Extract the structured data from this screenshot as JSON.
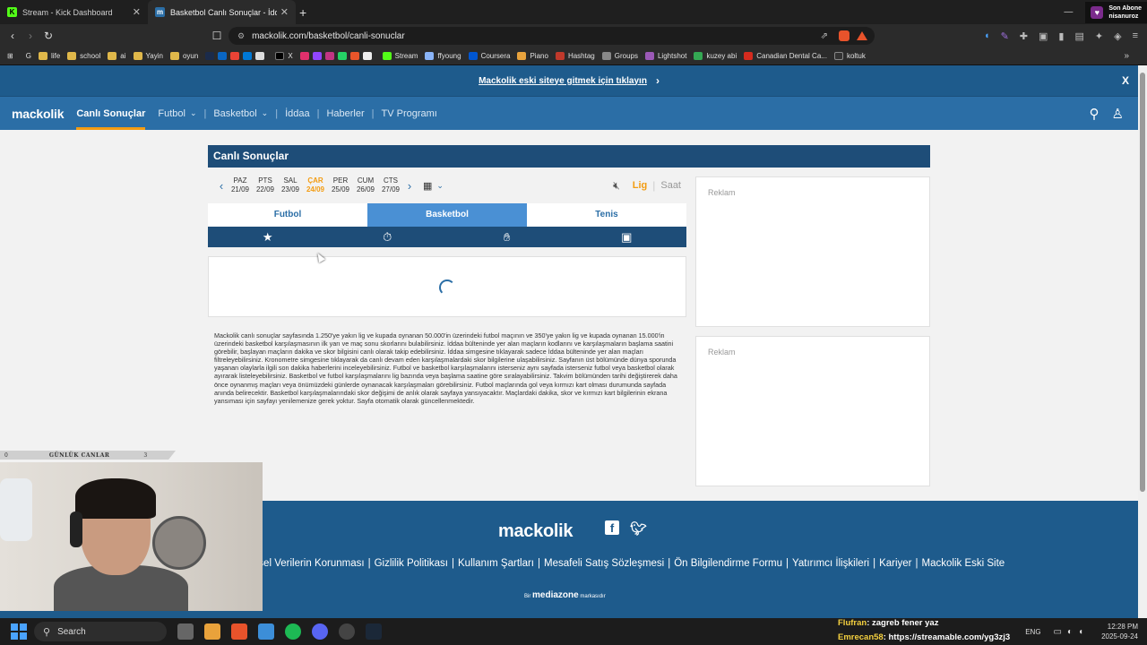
{
  "browser": {
    "tabs": [
      {
        "title": "Stream - Kick Dashboard",
        "favicon": "K",
        "favicon_color": "#53fc18",
        "active": false
      },
      {
        "title": "Basketbol Canlı Sonuçlar - İddaa",
        "favicon": "m",
        "favicon_color": "#2b6ea6",
        "active": true
      }
    ],
    "new_tab": "+",
    "url": "mackolik.com/basketbol/canli-sonuclar",
    "sub_alert": {
      "line1": "Son Abone",
      "line2": "nisanuroz"
    },
    "bookmarks": [
      "life",
      "school",
      "ai",
      "Yayin",
      "oyun",
      "X",
      "Stream",
      "ffyoung",
      "Coursera",
      "Piano",
      "Hashtag",
      "Groups",
      "Lightshot",
      "kuzey abi",
      "Canadian Dental Ca...",
      "koltuk"
    ]
  },
  "site": {
    "top_banner": "Mackolik eski siteye gitmek için tıklayın",
    "banner_close": "X",
    "logo": "mackolik",
    "nav": [
      {
        "label": "Canlı Sonuçlar",
        "active": true,
        "caret": false
      },
      {
        "label": "Futbol",
        "active": false,
        "caret": true
      },
      {
        "label": "Basketbol",
        "active": false,
        "caret": true
      },
      {
        "label": "İddaa",
        "active": false,
        "caret": false
      },
      {
        "label": "Haberler",
        "active": false,
        "caret": false
      },
      {
        "label": "TV Programı",
        "active": false,
        "caret": false
      }
    ],
    "section_title": "Canlı Sonuçlar",
    "days": [
      {
        "name": "PAZ",
        "date": "21/09",
        "selected": false
      },
      {
        "name": "PTS",
        "date": "22/09",
        "selected": false
      },
      {
        "name": "SAL",
        "date": "23/09",
        "selected": false
      },
      {
        "name": "ÇAR",
        "date": "24/09",
        "selected": true
      },
      {
        "name": "PER",
        "date": "25/09",
        "selected": false
      },
      {
        "name": "CUM",
        "date": "26/09",
        "selected": false
      },
      {
        "name": "CTS",
        "date": "27/09",
        "selected": false
      }
    ],
    "sort": {
      "lig": "Lig",
      "saat": "Saat"
    },
    "sport_tabs": [
      {
        "label": "Futbol",
        "active": false
      },
      {
        "label": "Basketbol",
        "active": true
      },
      {
        "label": "Tenis",
        "active": false
      }
    ],
    "description": "Mackolik canlı sonuçlar sayfasında 1.250'ye yakın lig ve kupada oynanan 50.000'in üzerindeki futbol maçının ve 350'ye yakın lig ve kupada oynanan 15.000'in üzerindeki basketbol karşılaşmasının ilk yarı ve maç sonu skorlarını bulabilirsiniz. İddaa bülteninde yer alan maçların kodlarını ve karşılaşmaların başlama saatini görebilir, başlayan maçların dakika ve skor bilgisini canlı olarak takip edebilirsiniz. İddaa simgesine tıklayarak sadece İddaa bülteninde yer alan maçları filtreleyebilirsiniz. Kronometre simgesine tıklayarak da canlı devam eden karşılaşmalardaki skor bilgilerine ulaşabilirsiniz. Sayfanın üst bölümünde dünya sporunda yaşanan olaylarla ilgili son dakika haberlerini inceleyebilirsiniz. Futbol ve basketbol karşılaşmalarını isterseniz aynı sayfada isterseniz futbol veya basketbol olarak ayırarak listeleyebilirsiniz. Basketbol ve futbol karşılaşmalarını lig bazında veya başlama saatine göre sıralayabilirsiniz. Takvim bölümünden tarihi değiştirerek daha önce oynanmış maçları veya önümüzdeki günlerde oynanacak karşılaşmaları görebilirsiniz. Futbol maçlarında gol veya kırmızı kart olması durumunda sayfada anında belirecektir. Basketbol karşılaşmalarındaki skor değişimi de anlık olarak sayfaya yansıyacaktır. Maçlardaki dakika, skor ve kırmızı kart bilgilerinin ekrana yansıması için sayfayı yenilemenize gerek yoktur. Sayfa otomatik olarak güncellenmektedir.",
    "ad_label": "Reklam",
    "footer": {
      "logo": "mackolik",
      "links": [
        "şisel Verilerin Korunması",
        "Gizlilik Politikası",
        "Kullanım Şartları",
        "Mesafeli Satış Sözleşmesi",
        "Ön Bilgilendirme Formu",
        "Yatırımcı İlişkileri",
        "Kariyer",
        "Mackolik Eski Site"
      ],
      "brand_prefix": "Bir",
      "brand": "mediazone",
      "brand_suffix": "markasıdır"
    }
  },
  "overlay": {
    "label_left": "0",
    "label_mid": "GÜNLÜK CANLAR",
    "label_right": "3"
  },
  "taskbar": {
    "search": "Search",
    "chat": [
      {
        "user": "Flufran",
        "msg": ": zagreb fener yaz"
      },
      {
        "user": "Emrecan58",
        "msg": ": https://streamable.com/yg3zj3"
      }
    ],
    "lang": "ENG",
    "time": "12:28 PM",
    "date": "2025-09-24"
  }
}
